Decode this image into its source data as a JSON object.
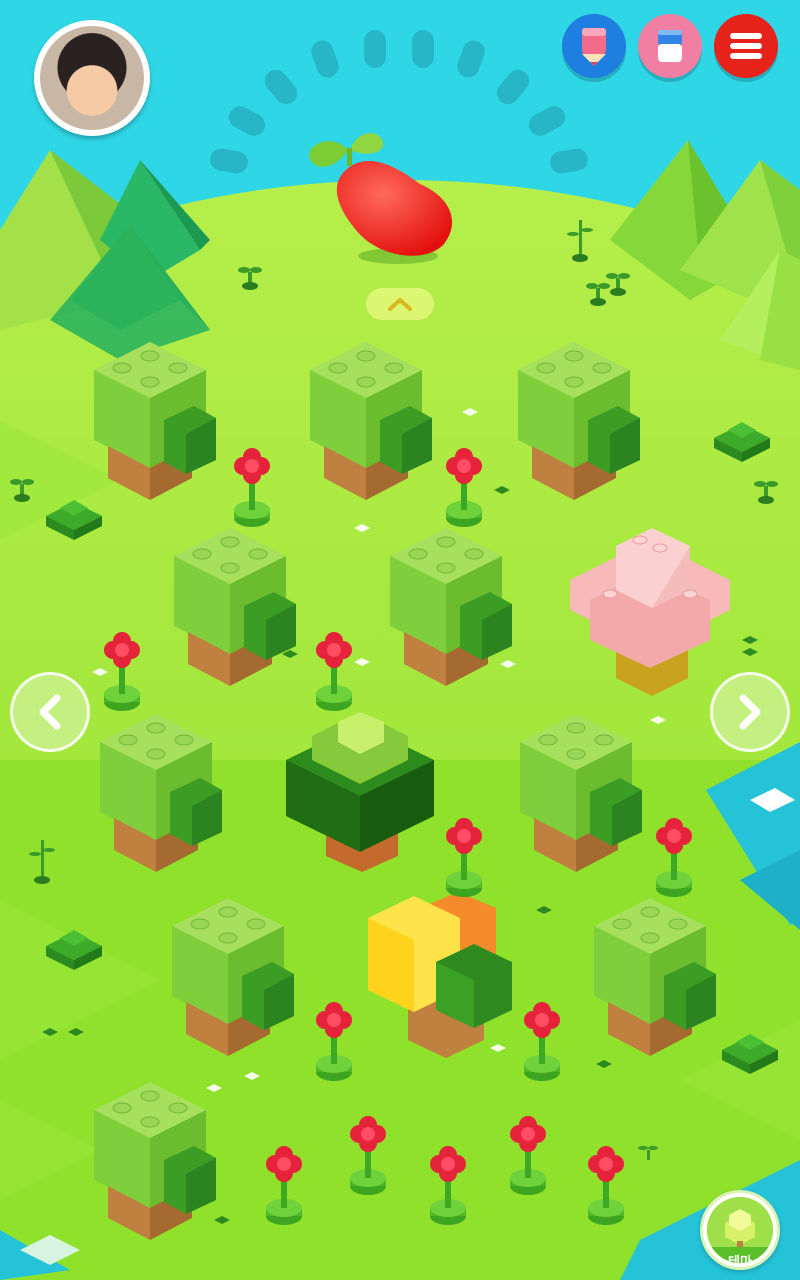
{
  "screen": "lego-garden",
  "hud": {
    "avatar": "player-avatar",
    "buttons": {
      "pencil": "pencil-icon",
      "eraser": "eraser-icon",
      "menu": "menu-icon"
    },
    "theme_label": "테마"
  },
  "colors": {
    "sky": "#2fd6e6",
    "grass": "#8fe62f",
    "bean": "#f01e1e",
    "tree_leaf": "#7cd24a",
    "tree_trunk": "#c0803f",
    "flower": "#e5233a"
  }
}
